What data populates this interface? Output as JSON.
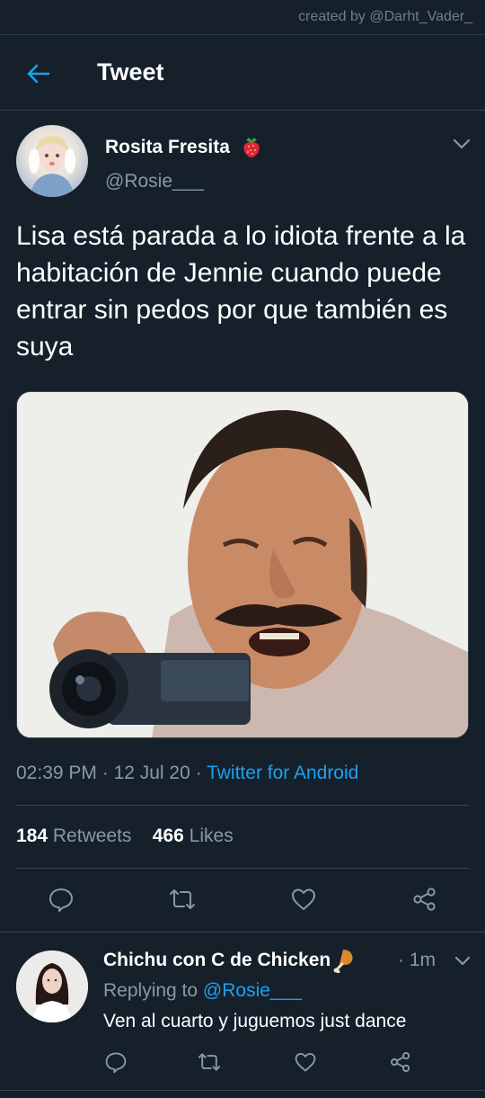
{
  "watermark": "created by @Darht_Vader_",
  "header": {
    "title": "Tweet",
    "back_icon": "arrow-left-icon"
  },
  "tweet": {
    "author_name": "Rosita Fresita",
    "author_emoji": "strawberry-icon",
    "author_handle": "@Rosie___",
    "text": "Lisa está parada a lo idiota frente a la habitación de Jennie cuando puede entrar sin pedos por que también es suya",
    "time": "02:39 PM",
    "separator1": " · ",
    "date": "12 Jul 20",
    "separator2": " · ",
    "source": "Twitter for Android",
    "retweets_count": "184",
    "retweets_label": "Retweets",
    "likes_count": "466",
    "likes_label": "Likes"
  },
  "actions": [
    "reply-icon",
    "retweet-icon",
    "like-icon",
    "share-icon"
  ],
  "reply": {
    "author_name": "Chichu con C de Chicken",
    "author_emoji": "drumstick-icon",
    "time": "· 1m",
    "replying_prefix": "Replying to ",
    "replying_to": "@Rosie___",
    "text": "Ven al cuarto y juguemos just dance"
  },
  "colors": {
    "background": "#15202b",
    "accent": "#1da1f2",
    "secondary_text": "#8899a6",
    "divider": "#38444d"
  }
}
